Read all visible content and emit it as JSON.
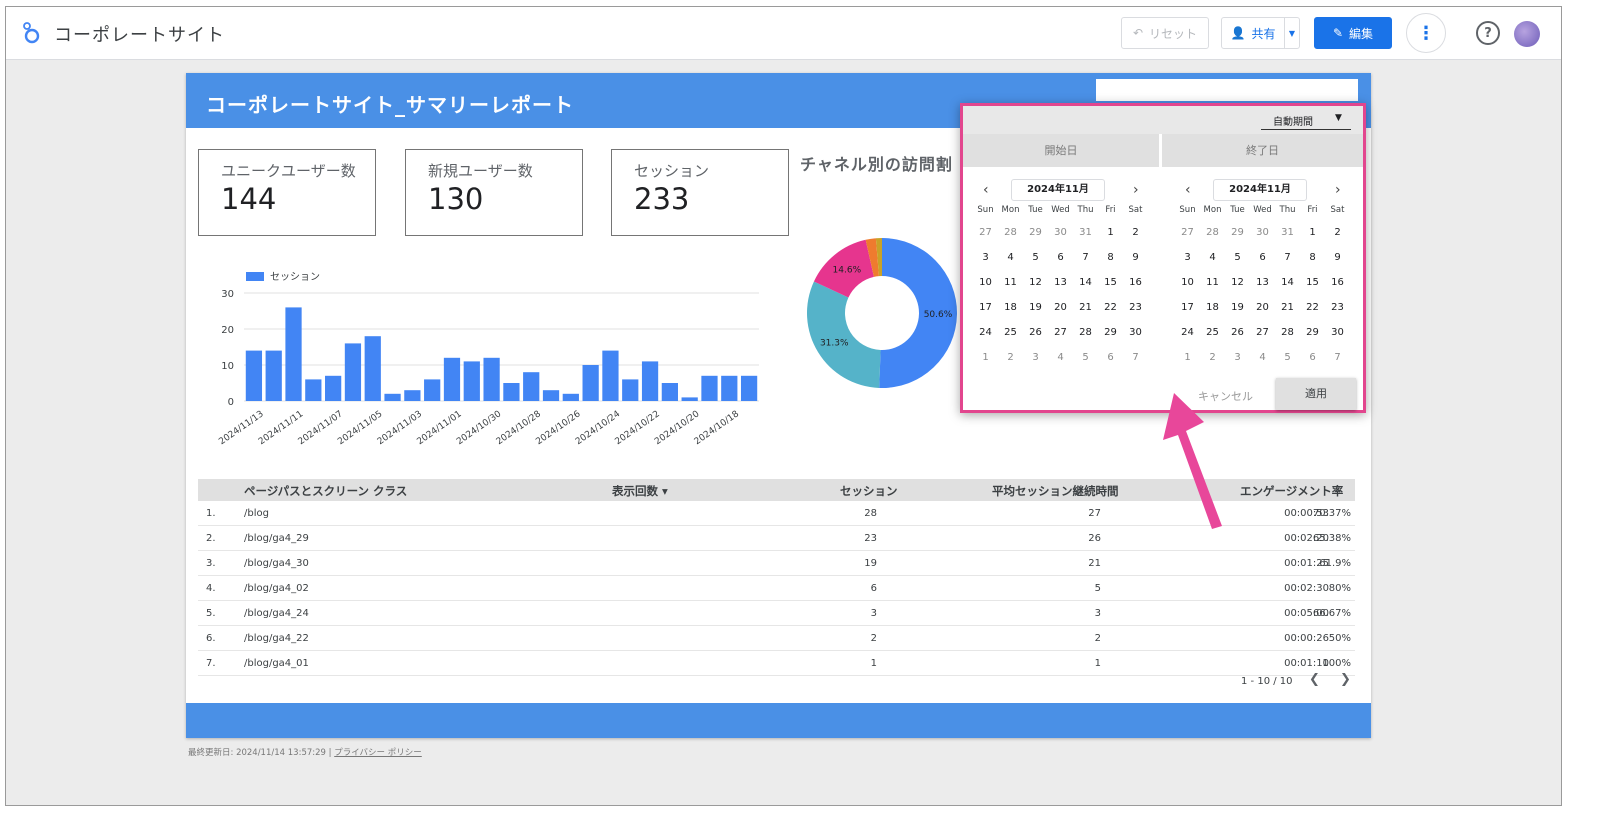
{
  "app": {
    "title": "コーポレートサイト"
  },
  "toolbar": {
    "reset_label": "リセット",
    "share_label": "共有",
    "edit_label": "編集"
  },
  "report": {
    "title": "コーポレートサイト_サマリーレポート",
    "kpis": [
      {
        "label": "ユニークユーザー数",
        "value": "144"
      },
      {
        "label": "新規ユーザー数",
        "value": "130"
      },
      {
        "label": "セッション",
        "value": "233"
      }
    ],
    "donut_title": "チャネル別の訪問割"
  },
  "chart_data": [
    {
      "type": "bar",
      "legend": [
        "セッション"
      ],
      "series": [
        {
          "name": "セッション",
          "values": [
            14,
            14,
            26,
            6,
            7,
            16,
            18,
            2,
            3,
            6,
            12,
            11,
            12,
            5,
            8,
            3,
            2,
            10,
            14,
            6,
            11,
            5,
            1,
            7,
            7,
            7
          ]
        }
      ],
      "x_tick_labels": [
        "2024/11/13",
        "2024/11/11",
        "2024/11/07",
        "2024/11/05",
        "2024/11/03",
        "2024/11/01",
        "2024/10/30",
        "2024/10/28",
        "2024/10/26",
        "2024/10/24",
        "2024/10/22",
        "2024/10/20",
        "2024/10/18"
      ],
      "y_ticks": [
        0,
        10,
        20,
        30
      ],
      "ylim": [
        0,
        30
      ],
      "grid": true,
      "legend_position": "top-left",
      "color": "#4285f4"
    },
    {
      "type": "pie",
      "donut": true,
      "slices": [
        {
          "value": 50.6,
          "label": "50.6%",
          "color": "#4285f4"
        },
        {
          "value": 31.3,
          "label": "31.3%",
          "color": "#55b3c9"
        },
        {
          "value": 14.6,
          "label": "14.6%",
          "color": "#e6358e"
        },
        {
          "value": 2.2,
          "label": "",
          "color": "#ef7b2e"
        },
        {
          "value": 1.3,
          "label": "",
          "color": "#c9a227"
        }
      ]
    }
  ],
  "table": {
    "headers": [
      "ページパスとスクリーン クラス",
      "表示回数 ▾",
      "セッション",
      "平均セッション継続時間",
      "エンゲージメント率"
    ],
    "rows": [
      {
        "num": "1.",
        "path": "/blog",
        "views": "28",
        "sessions": "27",
        "duration": "00:00:53",
        "rate": "70.37%"
      },
      {
        "num": "2.",
        "path": "/blog/ga4_29",
        "views": "23",
        "sessions": "26",
        "duration": "00:02:20",
        "rate": "65.38%"
      },
      {
        "num": "3.",
        "path": "/blog/ga4_30",
        "views": "19",
        "sessions": "21",
        "duration": "00:01:25",
        "rate": "61.9%"
      },
      {
        "num": "4.",
        "path": "/blog/ga4_02",
        "views": "6",
        "sessions": "5",
        "duration": "00:02:30",
        "rate": "80%"
      },
      {
        "num": "5.",
        "path": "/blog/ga4_24",
        "views": "3",
        "sessions": "3",
        "duration": "00:05:00",
        "rate": "66.67%"
      },
      {
        "num": "6.",
        "path": "/blog/ga4_22",
        "views": "2",
        "sessions": "2",
        "duration": "00:00:26",
        "rate": "50%"
      },
      {
        "num": "7.",
        "path": "/blog/ga4_01",
        "views": "1",
        "sessions": "1",
        "duration": "00:01:10",
        "rate": "100%"
      }
    ],
    "pager": "1 - 10 / 10"
  },
  "footer": {
    "updated": "最終更新日: 2024/11/14 13:57:29",
    "privacy": "プライバシー ポリシー"
  },
  "datepicker": {
    "preset": "自動期間",
    "start_tab": "開始日",
    "end_tab": "終了日",
    "calendars": [
      {
        "month": "2024年11月"
      },
      {
        "month": "2024年11月"
      }
    ],
    "weekdays": [
      "Sun",
      "Mon",
      "Tue",
      "Wed",
      "Thu",
      "Fri",
      "Sat"
    ],
    "weeks": [
      [
        "27",
        "28",
        "29",
        "30",
        "31",
        "1",
        "2"
      ],
      [
        "3",
        "4",
        "5",
        "6",
        "7",
        "8",
        "9"
      ],
      [
        "10",
        "11",
        "12",
        "13",
        "14",
        "15",
        "16"
      ],
      [
        "17",
        "18",
        "19",
        "20",
        "21",
        "22",
        "23"
      ],
      [
        "24",
        "25",
        "26",
        "27",
        "28",
        "29",
        "30"
      ],
      [
        "1",
        "2",
        "3",
        "4",
        "5",
        "6",
        "7"
      ]
    ],
    "cancel_label": "キャンセル",
    "apply_label": "適用"
  },
  "colors": {
    "accent": "#1a73e8",
    "header_blue": "#4a90e6",
    "highlight": "#e2468e"
  }
}
